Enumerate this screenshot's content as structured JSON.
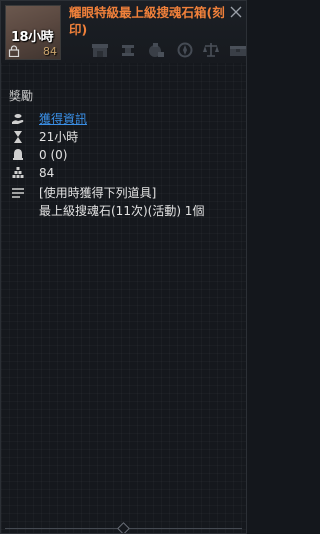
{
  "item": {
    "name": "耀眼特級最上級搜魂石箱(刻印)",
    "slot_time": "18小時",
    "slot_count": "84"
  },
  "icons": {
    "close": "close-icon",
    "lock": "lock-icon",
    "row_icons": [
      "shop-icon",
      "anvil-icon",
      "bag-icon",
      "compass-icon",
      "scale-icon",
      "chest-icon"
    ]
  },
  "section": {
    "title": "獎勵"
  },
  "rows": [
    {
      "icon": "hand-coin-icon",
      "text": "獲得資訊"
    },
    {
      "icon": "hourglass-icon",
      "text": "21小時"
    },
    {
      "icon": "bell-icon",
      "text": "0 (0)"
    },
    {
      "icon": "pyramid-icon",
      "text": "84"
    },
    {
      "icon": "list-icon",
      "text": "[使用時獲得下列道具]"
    },
    {
      "icon": "",
      "text": "最上級搜魂石(11次)(活動) 1個"
    }
  ],
  "colors": {
    "name": "#f0803a",
    "link": "#3a8fe6",
    "text": "#e2e2e2",
    "background": "#15181d"
  }
}
